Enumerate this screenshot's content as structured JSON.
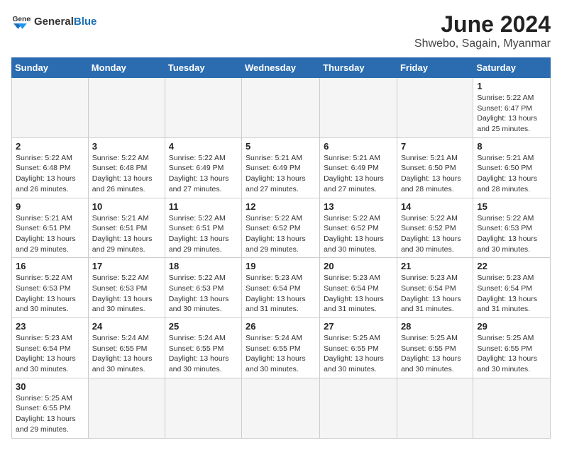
{
  "header": {
    "logo_general": "General",
    "logo_blue": "Blue",
    "month_year": "June 2024",
    "subtitle": "Shwebo, Sagain, Myanmar"
  },
  "days_of_week": [
    "Sunday",
    "Monday",
    "Tuesday",
    "Wednesday",
    "Thursday",
    "Friday",
    "Saturday"
  ],
  "weeks": [
    [
      {
        "day": "",
        "info": ""
      },
      {
        "day": "",
        "info": ""
      },
      {
        "day": "",
        "info": ""
      },
      {
        "day": "",
        "info": ""
      },
      {
        "day": "",
        "info": ""
      },
      {
        "day": "",
        "info": ""
      },
      {
        "day": "1",
        "info": "Sunrise: 5:22 AM\nSunset: 6:47 PM\nDaylight: 13 hours and 25 minutes."
      }
    ],
    [
      {
        "day": "2",
        "info": "Sunrise: 5:22 AM\nSunset: 6:48 PM\nDaylight: 13 hours and 26 minutes."
      },
      {
        "day": "3",
        "info": "Sunrise: 5:22 AM\nSunset: 6:48 PM\nDaylight: 13 hours and 26 minutes."
      },
      {
        "day": "4",
        "info": "Sunrise: 5:22 AM\nSunset: 6:49 PM\nDaylight: 13 hours and 27 minutes."
      },
      {
        "day": "5",
        "info": "Sunrise: 5:21 AM\nSunset: 6:49 PM\nDaylight: 13 hours and 27 minutes."
      },
      {
        "day": "6",
        "info": "Sunrise: 5:21 AM\nSunset: 6:49 PM\nDaylight: 13 hours and 27 minutes."
      },
      {
        "day": "7",
        "info": "Sunrise: 5:21 AM\nSunset: 6:50 PM\nDaylight: 13 hours and 28 minutes."
      },
      {
        "day": "8",
        "info": "Sunrise: 5:21 AM\nSunset: 6:50 PM\nDaylight: 13 hours and 28 minutes."
      }
    ],
    [
      {
        "day": "9",
        "info": "Sunrise: 5:21 AM\nSunset: 6:51 PM\nDaylight: 13 hours and 29 minutes."
      },
      {
        "day": "10",
        "info": "Sunrise: 5:21 AM\nSunset: 6:51 PM\nDaylight: 13 hours and 29 minutes."
      },
      {
        "day": "11",
        "info": "Sunrise: 5:22 AM\nSunset: 6:51 PM\nDaylight: 13 hours and 29 minutes."
      },
      {
        "day": "12",
        "info": "Sunrise: 5:22 AM\nSunset: 6:52 PM\nDaylight: 13 hours and 29 minutes."
      },
      {
        "day": "13",
        "info": "Sunrise: 5:22 AM\nSunset: 6:52 PM\nDaylight: 13 hours and 30 minutes."
      },
      {
        "day": "14",
        "info": "Sunrise: 5:22 AM\nSunset: 6:52 PM\nDaylight: 13 hours and 30 minutes."
      },
      {
        "day": "15",
        "info": "Sunrise: 5:22 AM\nSunset: 6:53 PM\nDaylight: 13 hours and 30 minutes."
      }
    ],
    [
      {
        "day": "16",
        "info": "Sunrise: 5:22 AM\nSunset: 6:53 PM\nDaylight: 13 hours and 30 minutes."
      },
      {
        "day": "17",
        "info": "Sunrise: 5:22 AM\nSunset: 6:53 PM\nDaylight: 13 hours and 30 minutes."
      },
      {
        "day": "18",
        "info": "Sunrise: 5:22 AM\nSunset: 6:53 PM\nDaylight: 13 hours and 30 minutes."
      },
      {
        "day": "19",
        "info": "Sunrise: 5:23 AM\nSunset: 6:54 PM\nDaylight: 13 hours and 31 minutes."
      },
      {
        "day": "20",
        "info": "Sunrise: 5:23 AM\nSunset: 6:54 PM\nDaylight: 13 hours and 31 minutes."
      },
      {
        "day": "21",
        "info": "Sunrise: 5:23 AM\nSunset: 6:54 PM\nDaylight: 13 hours and 31 minutes."
      },
      {
        "day": "22",
        "info": "Sunrise: 5:23 AM\nSunset: 6:54 PM\nDaylight: 13 hours and 31 minutes."
      }
    ],
    [
      {
        "day": "23",
        "info": "Sunrise: 5:23 AM\nSunset: 6:54 PM\nDaylight: 13 hours and 30 minutes."
      },
      {
        "day": "24",
        "info": "Sunrise: 5:24 AM\nSunset: 6:55 PM\nDaylight: 13 hours and 30 minutes."
      },
      {
        "day": "25",
        "info": "Sunrise: 5:24 AM\nSunset: 6:55 PM\nDaylight: 13 hours and 30 minutes."
      },
      {
        "day": "26",
        "info": "Sunrise: 5:24 AM\nSunset: 6:55 PM\nDaylight: 13 hours and 30 minutes."
      },
      {
        "day": "27",
        "info": "Sunrise: 5:25 AM\nSunset: 6:55 PM\nDaylight: 13 hours and 30 minutes."
      },
      {
        "day": "28",
        "info": "Sunrise: 5:25 AM\nSunset: 6:55 PM\nDaylight: 13 hours and 30 minutes."
      },
      {
        "day": "29",
        "info": "Sunrise: 5:25 AM\nSunset: 6:55 PM\nDaylight: 13 hours and 30 minutes."
      }
    ],
    [
      {
        "day": "30",
        "info": "Sunrise: 5:25 AM\nSunset: 6:55 PM\nDaylight: 13 hours and 29 minutes."
      },
      {
        "day": "",
        "info": ""
      },
      {
        "day": "",
        "info": ""
      },
      {
        "day": "",
        "info": ""
      },
      {
        "day": "",
        "info": ""
      },
      {
        "day": "",
        "info": ""
      },
      {
        "day": "",
        "info": ""
      }
    ]
  ]
}
